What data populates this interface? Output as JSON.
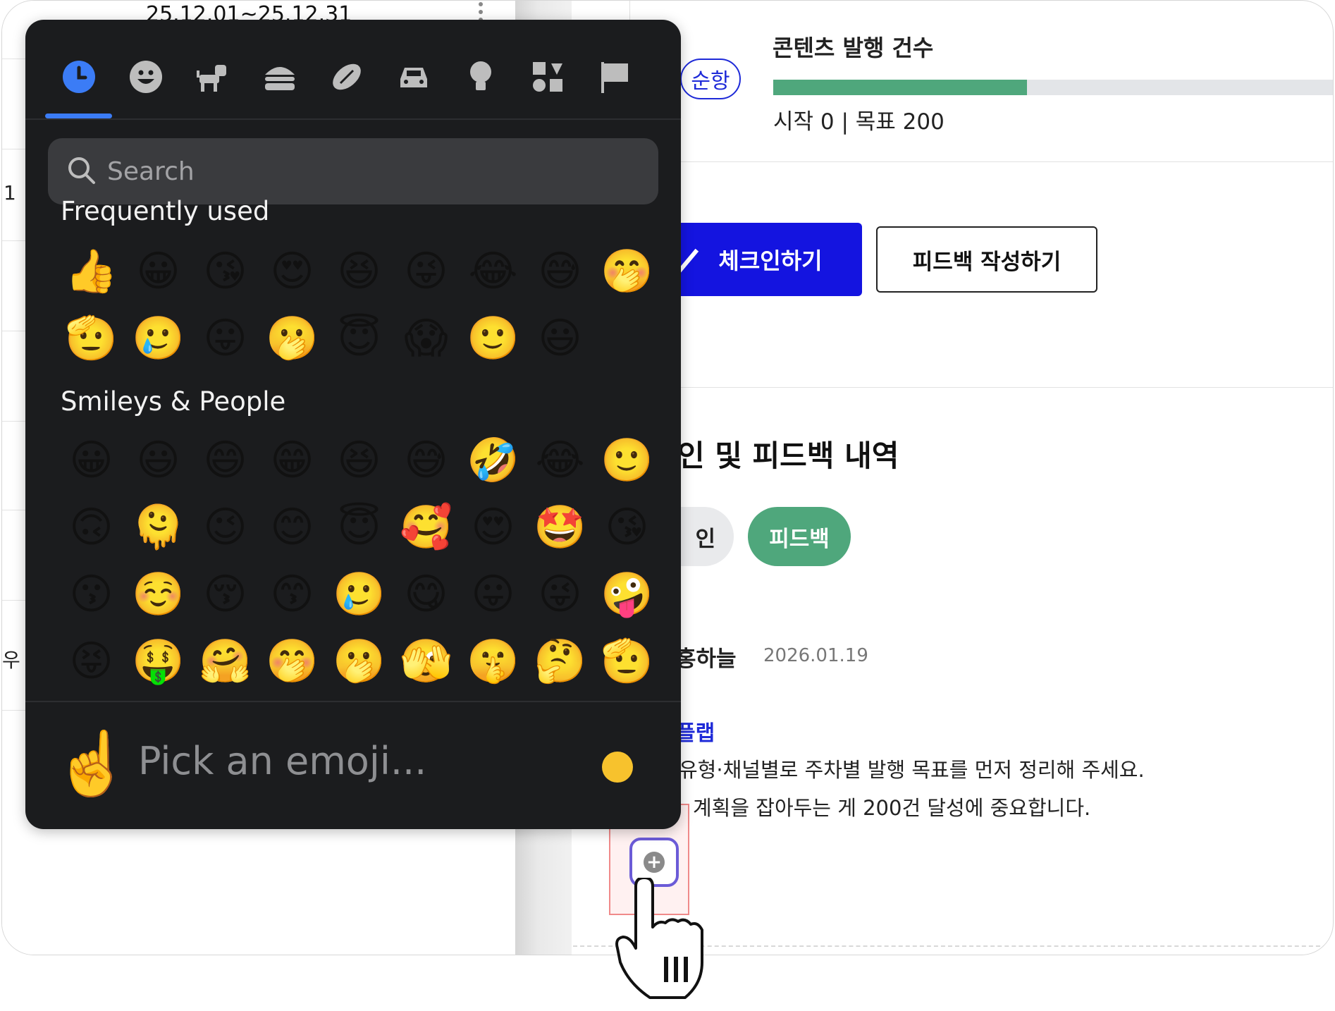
{
  "left": {
    "date_range": "25.12.01~25.12.31",
    "row_label_1": "1",
    "row_label_2": "우"
  },
  "metric": {
    "title": "콘텐츠 발행 건수",
    "status_pill": "순항",
    "progress_fraction": 0.45,
    "progress_text": "시작 0 | 목표 200",
    "progress_color": "#4fa77c"
  },
  "actions": {
    "checkin_label": "체크인하기",
    "feedback_label": "피드백 작성하기"
  },
  "history": {
    "title": "인 및 피드백 내역",
    "tab_checkin": "인",
    "tab_feedback": "피드백"
  },
  "entry": {
    "author": "홍하늘",
    "date": "2026.01.19",
    "tag": "플랩",
    "line1": "유형·채널별로 주차별 발행 목표를 먼저 정리해 주세요.",
    "line2": "계획을 잡아두는 게 200건 달성에 중요합니다."
  },
  "picker": {
    "categories": [
      "recent-icon",
      "smileys-icon",
      "animals-icon",
      "food-icon",
      "activity-icon",
      "travel-icon",
      "objects-icon",
      "symbols-icon",
      "flags-icon"
    ],
    "active_category": "recent-icon",
    "accent_color": "#3b7cf6",
    "search_placeholder": "Search",
    "frequently_used_title": "Frequently used",
    "frequently_used": [
      "👍",
      "😀",
      "😘",
      "😍",
      "😆",
      "😜",
      "😂",
      "😅",
      "🤭",
      "🫡",
      "🥲",
      "😛",
      "🫢",
      "😇",
      "😱",
      "🙂",
      "😃"
    ],
    "smileys_title": "Smileys & People",
    "smileys": [
      "😀",
      "😃",
      "😄",
      "😁",
      "😆",
      "😅",
      "🤣",
      "😂",
      "🙂",
      "🙃",
      "🫠",
      "😉",
      "😊",
      "😇",
      "🥰",
      "😍",
      "🤩",
      "😘",
      "😗",
      "☺️",
      "😚",
      "😙",
      "🥲",
      "😋",
      "😛",
      "😜",
      "🤪",
      "😝",
      "🤑",
      "🤗",
      "🤭",
      "🫢",
      "🫣",
      "🤫",
      "🤔",
      "🫡"
    ],
    "footer_emoji": "☝️",
    "footer_text": "Pick an emoji...",
    "skin_tone_color": "#f7c22d"
  },
  "add_reaction": {
    "plus": "+"
  }
}
